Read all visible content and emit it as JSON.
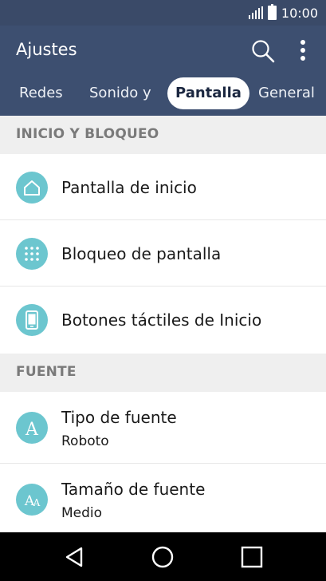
{
  "status_bar": {
    "time": "10:00",
    "signal_icon": "signal-bars-icon",
    "battery_icon": "battery-icon"
  },
  "app_bar": {
    "title": "Ajustes",
    "search_icon": "search-icon",
    "menu_icon": "more-vert-icon"
  },
  "tabs": [
    {
      "label": "Redes",
      "active": false
    },
    {
      "label": "Sonido y",
      "active": false
    },
    {
      "label": "Pantalla",
      "active": true
    },
    {
      "label": "General",
      "active": false
    }
  ],
  "sections": [
    {
      "header": "INICIO Y BLOQUEO",
      "items": [
        {
          "label": "Pantalla de inicio",
          "icon": "home-icon"
        },
        {
          "label": "Bloqueo de pantalla",
          "icon": "pattern-lock-icon"
        },
        {
          "label": "Botones táctiles de Inicio",
          "icon": "phone-icon"
        }
      ]
    },
    {
      "header": "FUENTE",
      "items": [
        {
          "label": "Tipo de fuente",
          "value": "Roboto",
          "icon": "font-type-icon"
        },
        {
          "label": "Tamaño de fuente",
          "value": "Medio",
          "icon": "font-size-icon"
        }
      ]
    }
  ],
  "nav_bar": {
    "back_icon": "back-triangle-icon",
    "home_icon": "home-circle-icon",
    "recents_icon": "recents-square-icon"
  },
  "colors": {
    "appbar": "#3d4f70",
    "statusbar": "#3a4a68",
    "icon_bg": "#6cc6cf",
    "section_bg": "#efefef"
  }
}
